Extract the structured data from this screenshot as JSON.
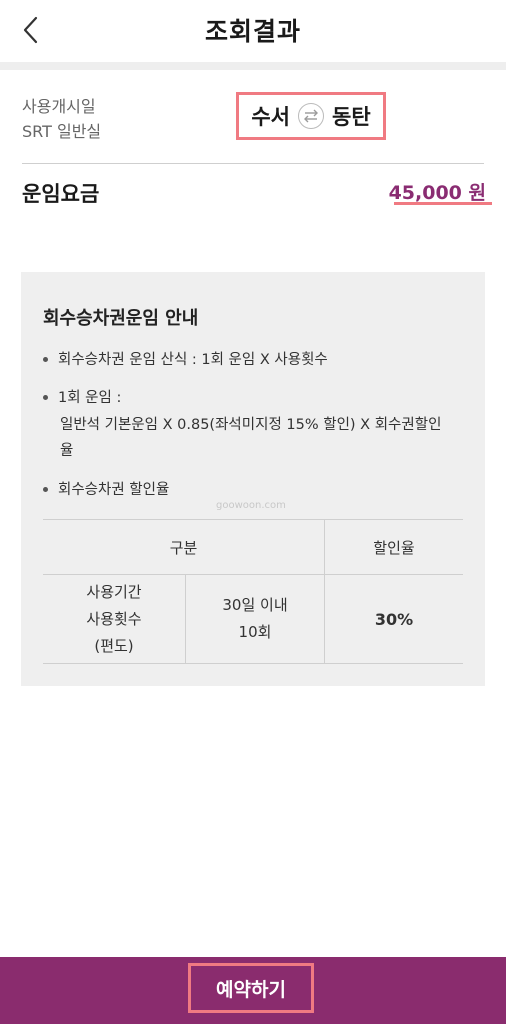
{
  "header": {
    "back_icon": "chevron-left-icon",
    "title": "조회결과"
  },
  "route": {
    "label_line1": "사용개시일",
    "label_line2": "SRT 일반실",
    "departure": "수서",
    "arrival": "동탄",
    "swap_icon": "swap-arrows-icon"
  },
  "fare": {
    "label": "운임요금",
    "value": "45,000 원"
  },
  "info": {
    "title": "회수승차권운임 안내",
    "bullets": [
      {
        "text": "회수승차권 운임 산식 : 1회 운임 X 사용횟수"
      },
      {
        "text": "1회 운임 :",
        "sub_line1": "일반석 기본운임 X 0.85(좌석미지정 15% 할인) X 회수권할인",
        "sub_line2": "율"
      },
      {
        "text": "회수승차권 할인율"
      }
    ],
    "watermark": "goowoon.com",
    "table": {
      "headers": [
        "구분",
        "할인율"
      ],
      "row": {
        "label_lines": [
          "사용기간",
          "사용횟수",
          "(편도)"
        ],
        "condition_lines": [
          "30일 이내",
          "10회"
        ],
        "rate": "30%"
      }
    }
  },
  "bottom": {
    "reserve_label": "예약하기"
  },
  "colors": {
    "accent": "#8a2c6e",
    "highlight": "#f07a82",
    "fare_text": "#8a2c72",
    "info_bg": "#efefef"
  }
}
